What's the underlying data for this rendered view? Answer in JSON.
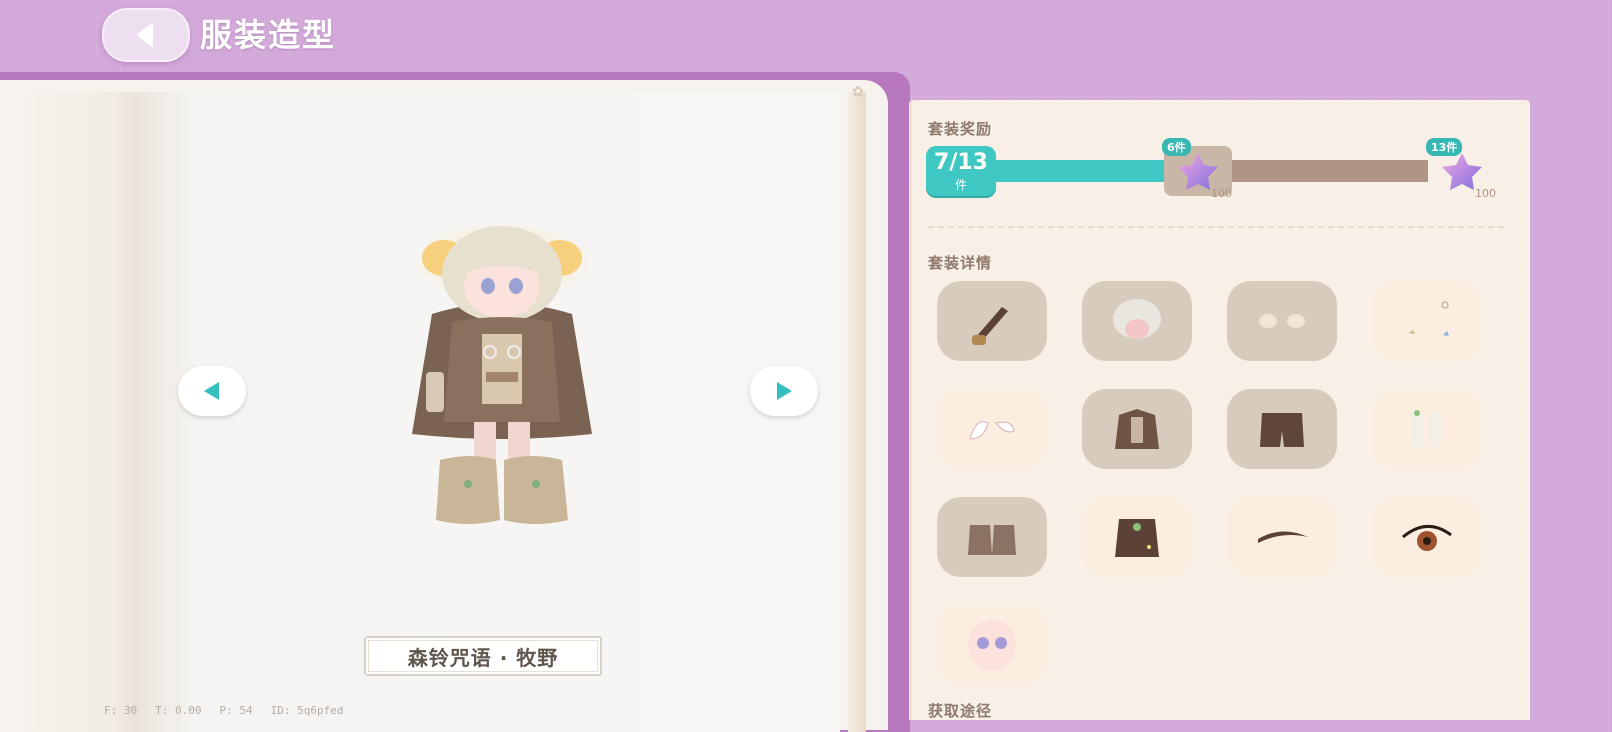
{
  "header": {
    "title": "服装造型"
  },
  "preview": {
    "outfit_name": "森铃咒语 · 牧野",
    "debug": [
      "F: 30",
      "T: 0.00",
      "P: 54",
      "ID: 5q6pfed"
    ]
  },
  "panel": {
    "reward_title": "套装奖励",
    "details_title": "套装详情",
    "source_title": "获取途径",
    "progress": {
      "collected": 7,
      "total": 13,
      "label": "7/13",
      "unit": "件",
      "fraction": 0.538
    },
    "rewards": [
      {
        "tier": "6件",
        "icon": "purple-star-icon",
        "amount": "100"
      },
      {
        "tier": "13件",
        "icon": "purple-star-icon",
        "amount": "100"
      }
    ],
    "items": [
      {
        "name": "item-weapon-lantern",
        "icon": "lantern-icon",
        "owned": true
      },
      {
        "name": "item-hair",
        "icon": "hair-icon",
        "owned": true
      },
      {
        "name": "item-gloves",
        "icon": "gloves-icon",
        "owned": true
      },
      {
        "name": "item-accessories",
        "icon": "trinket-icon",
        "owned": false
      },
      {
        "name": "item-ears",
        "icon": "ears-icon",
        "owned": false
      },
      {
        "name": "item-coat",
        "icon": "coat-icon",
        "owned": true
      },
      {
        "name": "item-shorts",
        "icon": "shorts-icon",
        "owned": true
      },
      {
        "name": "item-socks",
        "icon": "socks-icon",
        "owned": false
      },
      {
        "name": "item-boots",
        "icon": "boots-icon",
        "owned": true
      },
      {
        "name": "item-cape",
        "icon": "cape-icon",
        "owned": false
      },
      {
        "name": "item-eyebrows",
        "icon": "eyebrow-icon",
        "owned": false
      },
      {
        "name": "item-eyes",
        "icon": "eye-icon",
        "owned": false
      },
      {
        "name": "item-face",
        "icon": "face-icon",
        "owned": false
      }
    ]
  },
  "colors": {
    "accent": "#3fc8c3",
    "background": "#d2a9d9",
    "panel": "#f8efe6",
    "owned_slot": "#d7cbbd",
    "missing_slot": "#fbeee0"
  }
}
